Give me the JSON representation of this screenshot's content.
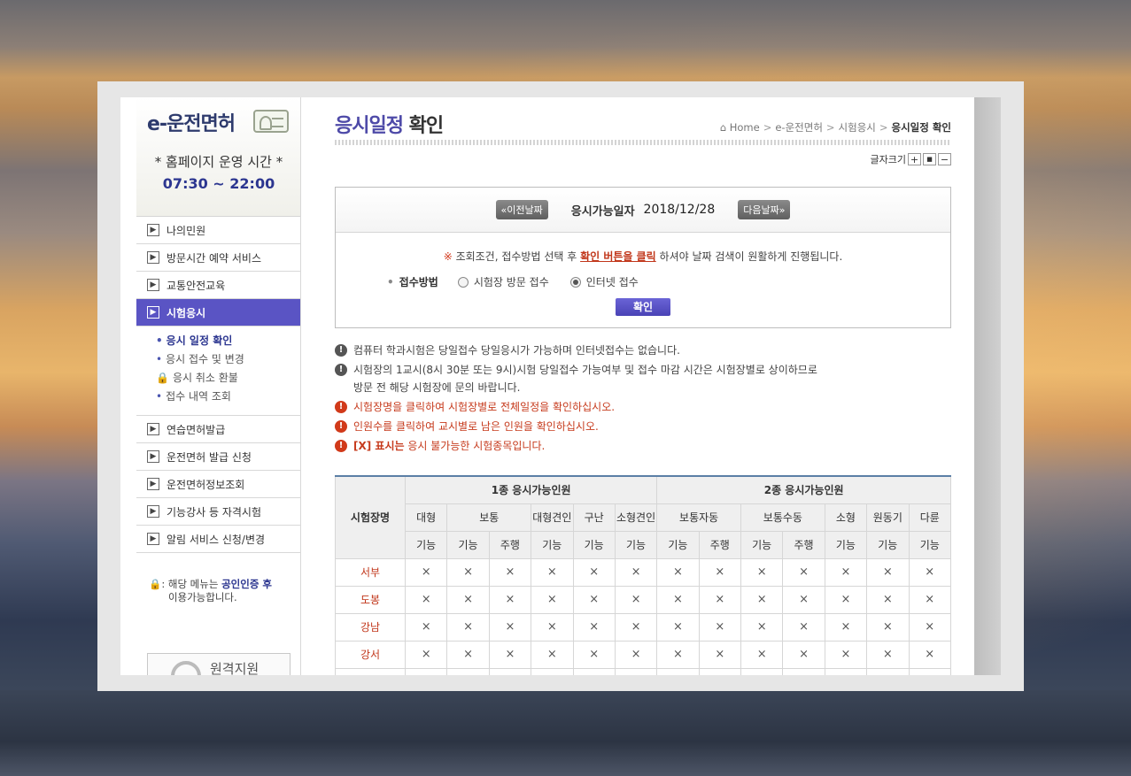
{
  "sidebar": {
    "logo": "e-운전면허",
    "hours_label": "* 홈페이지 운영 시간 *",
    "hours_value": "07:30 ~ 22:00",
    "menu_top": [
      {
        "label": "나의민원"
      },
      {
        "label": "방문시간 예약 서비스"
      },
      {
        "label": "교통안전교육"
      },
      {
        "label": "시험응시"
      }
    ],
    "submenu": [
      {
        "label": "응시 일정 확인"
      },
      {
        "label": "응시 접수 및 변경"
      },
      {
        "label": "응시 취소 환불"
      },
      {
        "label": "접수 내역 조회"
      }
    ],
    "menu_bottom": [
      {
        "label": "연습면허발급"
      },
      {
        "label": "운전면허 발급 신청"
      },
      {
        "label": "운전면허정보조회"
      },
      {
        "label": "기능강사 등 자격시험"
      },
      {
        "label": "알림 서비스 신청/변경"
      }
    ],
    "lock_note_prefix": ": 해당 메뉴는",
    "lock_note_hl": "공인인증 후",
    "lock_note_suffix": "이용가능합니다.",
    "remote_label": "원격지원"
  },
  "main": {
    "title_hl": "응시일정",
    "title_rest": " 확인",
    "breadcrumb": [
      "Home",
      "e-운전면허",
      "시험응시",
      "응시일정 확인"
    ],
    "fontsize_label": "글자크기",
    "fontsize_buttons": [
      "+",
      "■",
      "−"
    ]
  },
  "search": {
    "prev_label": "«이전날짜",
    "next_label": "다음날짜»",
    "date_label": "응시가능일자",
    "date_value": "2018/12/28",
    "notice_mark": "※",
    "notice_before": " 조회조건, 접수방법 선택 후 ",
    "notice_link": "확인 버튼을 클릭",
    "notice_after": " 하셔야 날짜 검색이 원활하게 진행됩니다.",
    "method_label": "접수방법",
    "method_options": [
      "시험장 방문 접수",
      "인터넷 접수"
    ],
    "method_selected": "인터넷 접수",
    "confirm_label": "확인"
  },
  "info": [
    {
      "text": "컴퓨터 학과시험은 당일접수 당일응시가 가능하며 인터넷접수는 없습니다.",
      "type": "gray"
    },
    {
      "text": "시험장의 1교시(8시 30분 또는 9시)시험 당일접수 가능여부 및 접수 마감 시간은 시험장별로 상이하므로",
      "text2": "방문 전 해당 시험장에 문의 바랍니다.",
      "type": "gray"
    },
    {
      "text": "시험장명을 클릭하여 시험장별로 전체일정을 확인하십시오.",
      "type": "red"
    },
    {
      "text": "인원수를 클릭하여 교시별로 남은 인원을 확인하십시오.",
      "type": "red"
    },
    {
      "strong": "[X] 표시는",
      "text": " 응시 불가능한 시험종목입니다.",
      "type": "red"
    }
  ],
  "table": {
    "center_header": "시험장명",
    "group1": "1종 응시가능인원",
    "group2": "2종 응시가능인원",
    "license_types": [
      {
        "name": "대형",
        "tests": [
          "기능"
        ]
      },
      {
        "name": "보통",
        "tests": [
          "기능",
          "주행"
        ]
      },
      {
        "name": "대형견인",
        "tests": [
          "기능"
        ]
      },
      {
        "name": "구난",
        "tests": [
          "기능"
        ]
      },
      {
        "name": "소형견인",
        "tests": [
          "기능"
        ]
      },
      {
        "name": "보통자동",
        "tests": [
          "기능",
          "주행"
        ]
      },
      {
        "name": "보통수동",
        "tests": [
          "기능",
          "주행"
        ]
      },
      {
        "name": "소형",
        "tests": [
          "기능"
        ]
      },
      {
        "name": "원동기",
        "tests": [
          "기능"
        ]
      },
      {
        "name": "다륜",
        "tests": [
          "기능"
        ]
      }
    ],
    "rows": [
      {
        "center": "서부",
        "cells": [
          "×",
          "×",
          "×",
          "×",
          "×",
          "×",
          "×",
          "×",
          "×",
          "×",
          "×",
          "×",
          "×"
        ]
      },
      {
        "center": "도봉",
        "cells": [
          "×",
          "×",
          "×",
          "×",
          "×",
          "×",
          "×",
          "×",
          "×",
          "×",
          "×",
          "×",
          "×"
        ]
      },
      {
        "center": "강남",
        "cells": [
          "×",
          "×",
          "×",
          "×",
          "×",
          "×",
          "×",
          "×",
          "×",
          "×",
          "×",
          "×",
          "×"
        ]
      },
      {
        "center": "강서",
        "cells": [
          "×",
          "×",
          "×",
          "×",
          "×",
          "×",
          "×",
          "×",
          "×",
          "×",
          "×",
          "×",
          "×"
        ]
      },
      {
        "center": "",
        "cells": [
          "",
          "",
          "",
          "",
          "",
          "",
          "",
          "",
          "",
          "",
          "",
          "",
          ""
        ]
      }
    ]
  }
}
